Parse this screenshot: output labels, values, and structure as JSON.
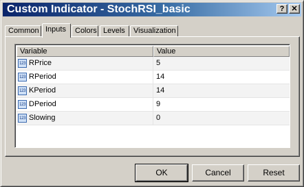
{
  "window": {
    "title": "Custom Indicator - StochRSI_basic",
    "help_label": "?",
    "close_label": "✕"
  },
  "tabs": [
    {
      "label": "Common",
      "active": false
    },
    {
      "label": "Inputs",
      "active": true
    },
    {
      "label": "Colors",
      "active": false
    },
    {
      "label": "Levels",
      "active": false
    },
    {
      "label": "Visualization",
      "active": false
    }
  ],
  "grid": {
    "headers": {
      "variable": "Variable",
      "value": "Value"
    },
    "icon_text": "123",
    "rows": [
      {
        "variable": "RPrice",
        "value": "5"
      },
      {
        "variable": "RPeriod",
        "value": "14"
      },
      {
        "variable": "KPeriod",
        "value": "14"
      },
      {
        "variable": "DPeriod",
        "value": "9"
      },
      {
        "variable": "Slowing",
        "value": "0"
      }
    ]
  },
  "buttons": {
    "ok": "OK",
    "cancel": "Cancel",
    "reset": "Reset"
  },
  "colors": {
    "title_gradient_start": "#0a246a",
    "title_gradient_end": "#a6caf0",
    "face": "#d4d0c8"
  }
}
